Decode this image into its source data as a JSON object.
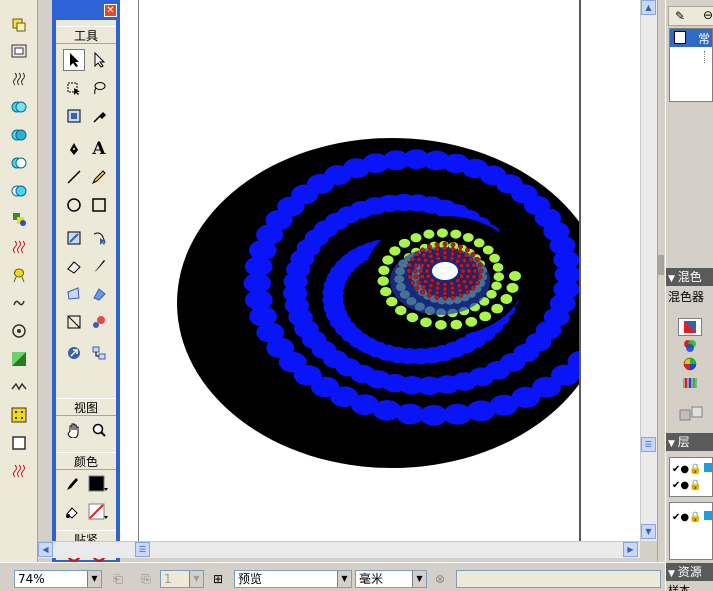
{
  "tools": {
    "close_label": "✕",
    "section_tools": "工具",
    "section_view": "视图",
    "section_colors": "颜色",
    "section_snap": "贴紧"
  },
  "layers_panel": {
    "first_item_label": "常"
  },
  "mixer_panel": {
    "title": "混色",
    "tab_label": "混色器"
  },
  "layer_panel": {
    "title": "层"
  },
  "assets_panel": {
    "title": "资源",
    "tab_label": "样本"
  },
  "status": {
    "zoom_value": "74%",
    "page_value": "1",
    "preview_value": "预览",
    "unit_value": "毫米"
  },
  "colors": {
    "disc": "#000000",
    "outer_dots": "#0a14f8",
    "inner_dots": "#aaf54a",
    "core_dots": "#c01818",
    "inner_disc": "#1e3ab4",
    "title_bar": "#2e62d6"
  }
}
